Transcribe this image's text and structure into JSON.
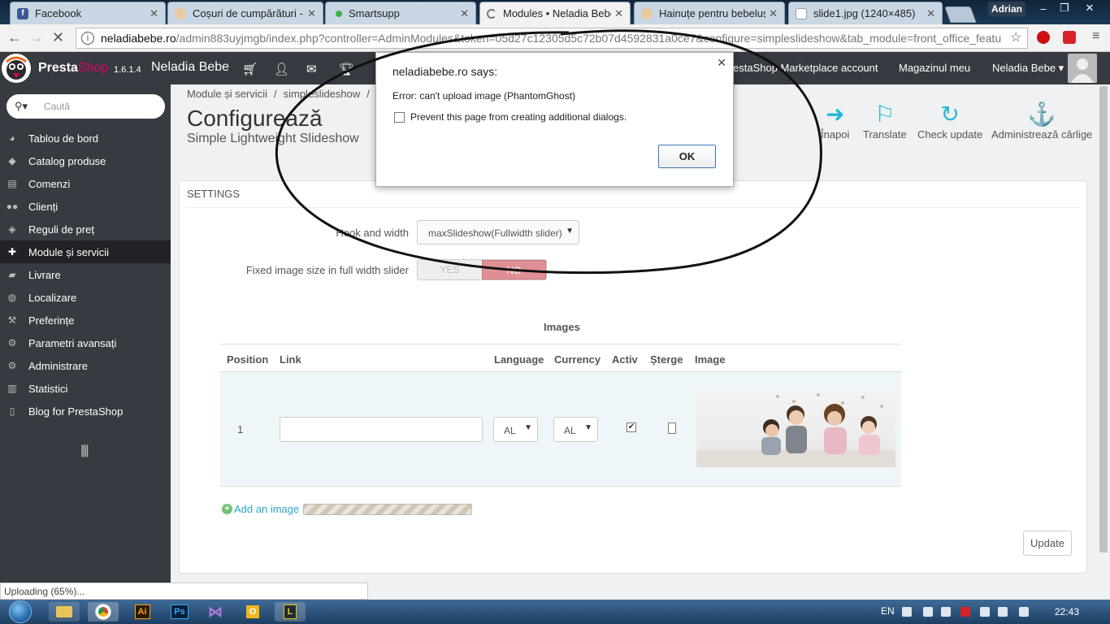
{
  "browser": {
    "tabs": [
      {
        "title": "Facebook",
        "favicon": "facebook-icon"
      },
      {
        "title": "Coșuri de cumpărături -",
        "favicon": "store-icon"
      },
      {
        "title": "Smartsupp",
        "favicon": "green-dot-icon"
      },
      {
        "title": "Modules • Neladia Bebe",
        "favicon": "loading-spinner-icon",
        "active": true
      },
      {
        "title": "Hainuțe pentru bebeluși",
        "favicon": "store-icon"
      },
      {
        "title": "slide1.jpg (1240×485)",
        "favicon": "file-icon"
      }
    ],
    "profile_name": "Adrian",
    "url_host": "neladiabebe.ro",
    "url_path": "/admin883uyjmgb/index.php?controller=AdminModules&token=05d27c12305d5c72b07d4592831a0ce7&configure=simpleslideshow&tab_module=front_office_featu"
  },
  "header": {
    "brand_presta": "Presta",
    "brand_shop": "Shop",
    "version": "1.6.1.4",
    "shop_name": "Neladia Bebe",
    "marketplace": "PrestaShop Marketplace account",
    "my_shop": "Magazinul meu",
    "user_menu": "Neladia Bebe ▾"
  },
  "sidebar": {
    "search_placeholder": "Caută",
    "items": [
      {
        "label": "Tablou de bord",
        "icon": "dashboard-icon"
      },
      {
        "label": "Catalog produse",
        "icon": "tag-icon"
      },
      {
        "label": "Comenzi",
        "icon": "orders-icon"
      },
      {
        "label": "Clienți",
        "icon": "users-icon"
      },
      {
        "label": "Reguli de preț",
        "icon": "price-icon"
      },
      {
        "label": "Module și servicii",
        "icon": "puzzle-icon",
        "active": true
      },
      {
        "label": "Livrare",
        "icon": "truck-icon"
      },
      {
        "label": "Localizare",
        "icon": "globe-icon"
      },
      {
        "label": "Preferințe",
        "icon": "wrench-icon"
      },
      {
        "label": "Parametri avansați",
        "icon": "cogs-icon"
      },
      {
        "label": "Administrare",
        "icon": "gear-icon"
      },
      {
        "label": "Statistici",
        "icon": "chart-icon"
      },
      {
        "label": "Blog for PrestaShop",
        "icon": "file-icon"
      }
    ]
  },
  "page": {
    "breadcrumb": [
      "Module și servicii",
      "simpleslideshow"
    ],
    "title": "Configurează",
    "subtitle": "Simple Lightweight Slideshow",
    "toolbar": [
      {
        "label": "Înapoi",
        "icon": "back-arrow-icon"
      },
      {
        "label": "Translate",
        "icon": "flag-icon"
      },
      {
        "label": "Check update",
        "icon": "refresh-icon"
      },
      {
        "label": "Administrează cârlige",
        "icon": "anchor-icon"
      }
    ]
  },
  "settings": {
    "panel_title": "SETTINGS",
    "hook_label": "Hook and width",
    "hook_value": "maxSlideshow(Fullwidth slider)",
    "fixed_size_label": "Fixed image size in full width slider",
    "yes_label": "YES",
    "no_label": "NO",
    "fixed_size_value": "NO"
  },
  "images": {
    "title": "Images",
    "columns": [
      "Position",
      "Link",
      "Language",
      "Currency",
      "Activ",
      "Șterge",
      "Image"
    ],
    "rows": [
      {
        "position": "1",
        "link": "",
        "language": "AL",
        "currency": "AL",
        "active": true
      }
    ],
    "add_label": "Add an image",
    "update_label": "Update"
  },
  "status_bar": "Uploading (65%)...",
  "upload_progress": 0.65,
  "dialog": {
    "title": "neladiabebe.ro says:",
    "message": "Error: can't upload image (PhantomGhost)",
    "checkbox_label": "Prevent this page from creating additional dialogs.",
    "ok_label": "OK"
  },
  "taskbar": {
    "apps": [
      "explorer-icon",
      "chrome-icon",
      "illustrator-icon",
      "photoshop-icon",
      "visual-studio-icon",
      "outlook-icon",
      "l-app-icon"
    ],
    "app_labels": {
      "illustrator": "Ai",
      "photoshop": "Ps",
      "outlook": "O",
      "l_app": "L"
    },
    "language": "EN",
    "time": "22:43"
  },
  "colors": {
    "ps_dark": "#363a41",
    "ps_pink": "#df0067",
    "ps_blue": "#25b9d7",
    "no_red": "#e08f95"
  }
}
